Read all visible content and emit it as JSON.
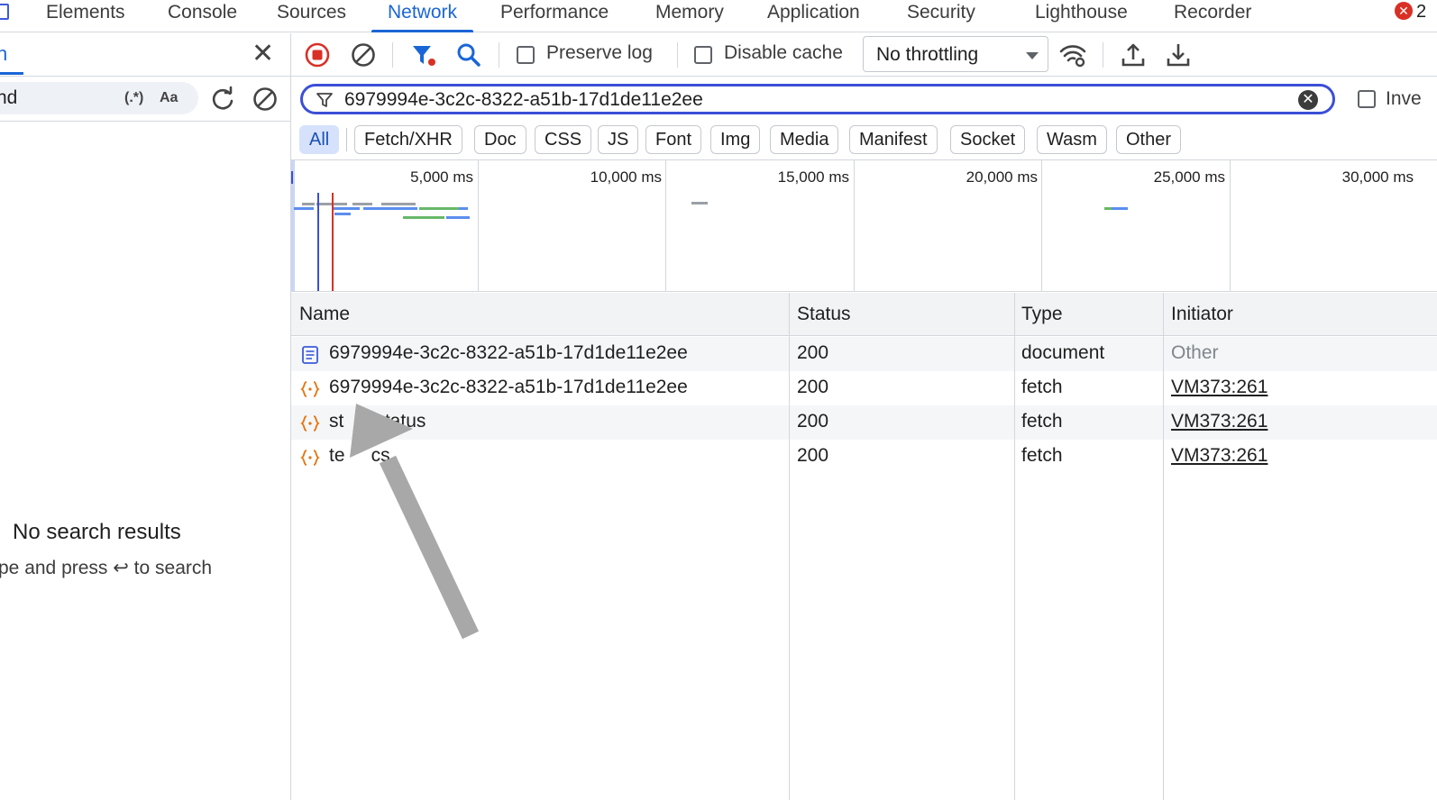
{
  "tabs": [
    {
      "label": "Elements",
      "active": false
    },
    {
      "label": "Console",
      "active": false
    },
    {
      "label": "Sources",
      "active": false
    },
    {
      "label": "Network",
      "active": true
    },
    {
      "label": "Performance",
      "active": false
    },
    {
      "label": "Memory",
      "active": false
    },
    {
      "label": "Application",
      "active": false
    },
    {
      "label": "Security",
      "active": false
    },
    {
      "label": "Lighthouse",
      "active": false
    },
    {
      "label": "Recorder",
      "active": false
    }
  ],
  "error_count": "2",
  "left_panel": {
    "search_tab_glyph": "n",
    "search_query": "nd",
    "regex_label": "(.*)",
    "case_label": "Aa",
    "no_results_title": "No search results",
    "no_results_hint": "pe and press ↩ to search"
  },
  "toolbar": {
    "preserve_log_label": "Preserve log",
    "disable_cache_label": "Disable cache",
    "throttling_value": "No throttling"
  },
  "filter": {
    "value": "6979994e-3c2c-8322-a51b-17d1de11e2ee",
    "invert_label": "Inve"
  },
  "type_filters": [
    {
      "label": "All",
      "active": true
    },
    {
      "label": "Fetch/XHR",
      "active": false
    },
    {
      "label": "Doc",
      "active": false
    },
    {
      "label": "CSS",
      "active": false
    },
    {
      "label": "JS",
      "active": false
    },
    {
      "label": "Font",
      "active": false
    },
    {
      "label": "Img",
      "active": false
    },
    {
      "label": "Media",
      "active": false
    },
    {
      "label": "Manifest",
      "active": false
    },
    {
      "label": "Socket",
      "active": false
    },
    {
      "label": "Wasm",
      "active": false
    },
    {
      "label": "Other",
      "active": false
    }
  ],
  "overview": {
    "tick_labels": [
      "5,000 ms",
      "10,000 ms",
      "15,000 ms",
      "20,000 ms",
      "25,000 ms",
      "30,000 ms"
    ],
    "colors": {
      "dom_content_loaded": "#3b4fd6",
      "load": "#d93025",
      "waiting": "#9aa0a6",
      "receiving": "#5b8def",
      "green": "#67b868"
    }
  },
  "table": {
    "columns": [
      "Name",
      "Status",
      "Type",
      "Initiator"
    ],
    "rows": [
      {
        "icon": "document-icon",
        "name": "6979994e-3c2c-8322-a51b-17d1de11e2ee",
        "status": "200",
        "type": "document",
        "initiator": "Other",
        "initiator_link": false
      },
      {
        "icon": "fetch-icon",
        "name": "6979994e-3c2c-8322-a51b-17d1de11e2ee",
        "status": "200",
        "type": "fetch",
        "initiator": "VM373:261",
        "initiator_link": true
      },
      {
        "icon": "fetch-icon",
        "name": "st      status",
        "status": "200",
        "type": "fetch",
        "initiator": "VM373:261",
        "initiator_link": true
      },
      {
        "icon": "fetch-icon",
        "name": "te     cs",
        "status": "200",
        "type": "fetch",
        "initiator": "VM373:261",
        "initiator_link": true
      }
    ]
  },
  "colors": {
    "accent": "#1a66d6",
    "record_red": "#d93025",
    "fetch_orange": "#e8710a",
    "arrow_gray": "#a8a8a8"
  }
}
